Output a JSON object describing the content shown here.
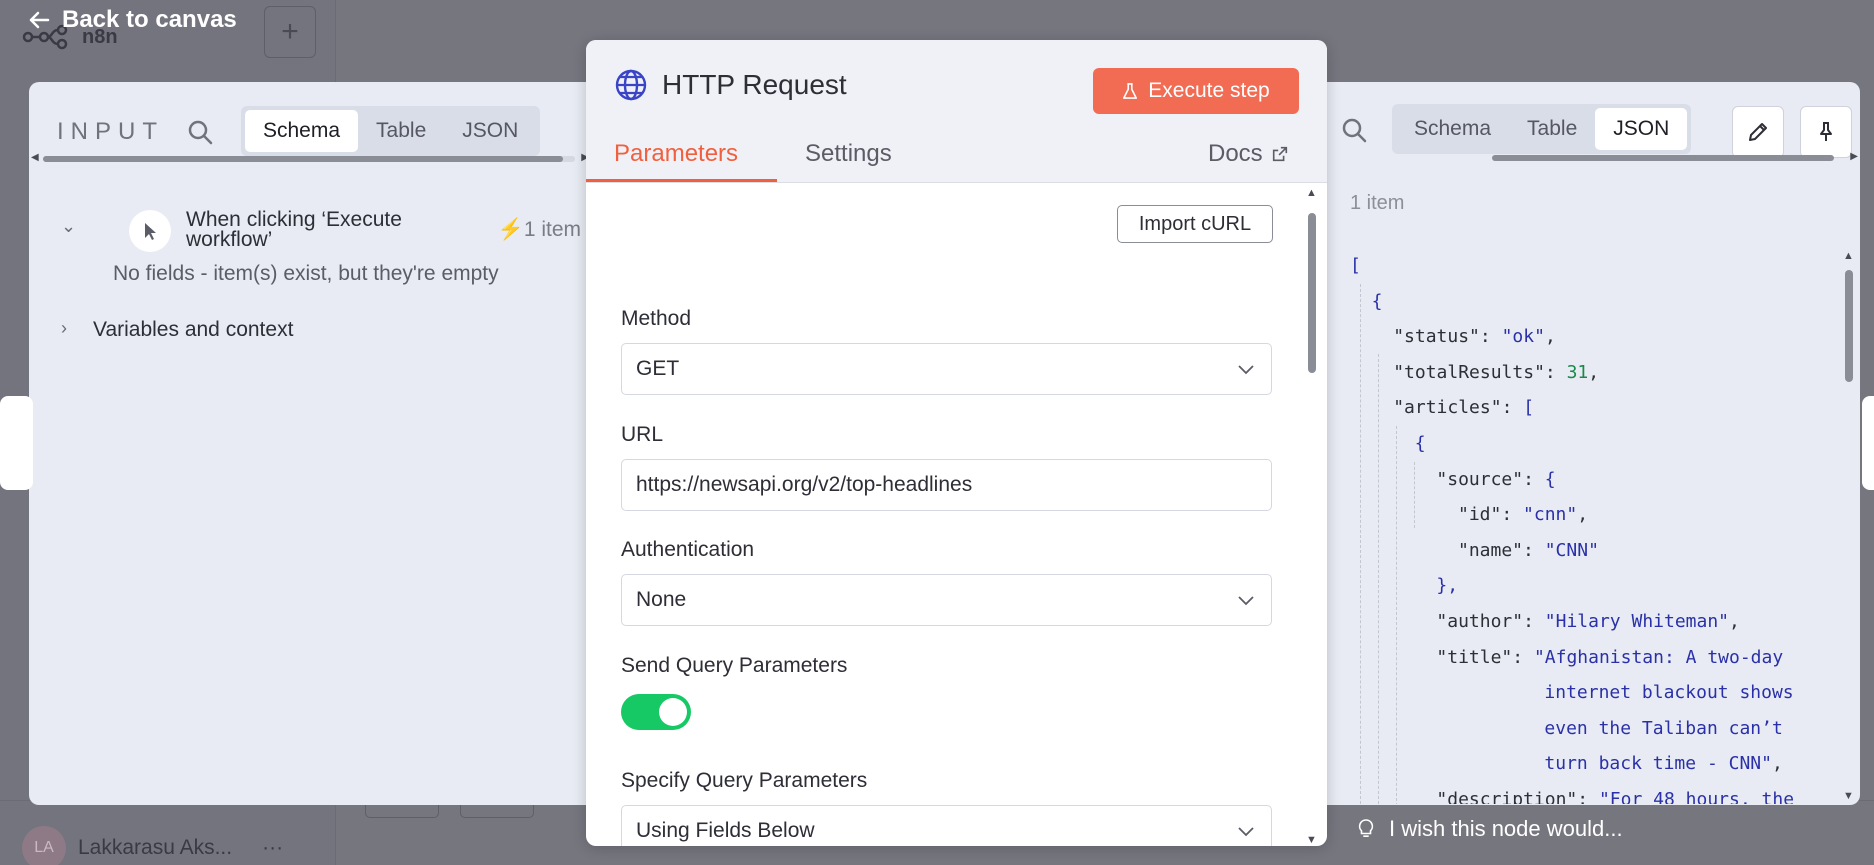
{
  "app": {
    "logo_text": "n8n",
    "user_initials": "LA",
    "user_name": "Lakkarasu Aks...",
    "user_menu": "···"
  },
  "back": {
    "label": "Back to canvas"
  },
  "input_panel": {
    "title": "INPUT",
    "tabs": [
      "Schema",
      "Table",
      "JSON"
    ],
    "active_tab": "Schema",
    "node": {
      "label": "When clicking ‘Execute workflow’",
      "count": "1 item"
    },
    "empty_message": "No fields - item(s) exist, but they're empty",
    "variables_label": "Variables and context"
  },
  "modal": {
    "title": "HTTP Request",
    "execute_label": "Execute step",
    "tabs": [
      "Parameters",
      "Settings"
    ],
    "active_tab": "Parameters",
    "docs_label": "Docs",
    "import_curl_label": "Import cURL",
    "fields": {
      "method": {
        "label": "Method",
        "value": "GET"
      },
      "url": {
        "label": "URL",
        "value": "https://newsapi.org/v2/top-headlines"
      },
      "authentication": {
        "label": "Authentication",
        "value": "None"
      },
      "send_query": {
        "label": "Send Query Parameters",
        "enabled": true
      },
      "specify_query": {
        "label": "Specify Query Parameters",
        "value": "Using Fields Below"
      }
    }
  },
  "output_panel": {
    "tabs": [
      "Schema",
      "Table",
      "JSON"
    ],
    "active_tab": "JSON",
    "items_count": "1 item",
    "json_lines": [
      [
        {
          "t": "p",
          "v": "["
        }
      ],
      [
        {
          "t": "p",
          "v": "{"
        }
      ],
      [
        {
          "t": "k",
          "v": "\"status\""
        },
        {
          "t": "k",
          "v": ": "
        },
        {
          "t": "s",
          "v": "\"ok\""
        },
        {
          "t": "k",
          "v": ","
        }
      ],
      [
        {
          "t": "k",
          "v": "\"totalResults\""
        },
        {
          "t": "k",
          "v": ": "
        },
        {
          "t": "n",
          "v": "31"
        },
        {
          "t": "k",
          "v": ","
        }
      ],
      [
        {
          "t": "k",
          "v": "\"articles\""
        },
        {
          "t": "k",
          "v": ": "
        },
        {
          "t": "p",
          "v": "["
        }
      ],
      [
        {
          "t": "p",
          "v": "{"
        }
      ],
      [
        {
          "t": "k",
          "v": "\"source\""
        },
        {
          "t": "k",
          "v": ": "
        },
        {
          "t": "p",
          "v": "{"
        }
      ],
      [
        {
          "t": "k",
          "v": "\"id\""
        },
        {
          "t": "k",
          "v": ": "
        },
        {
          "t": "s",
          "v": "\"cnn\""
        },
        {
          "t": "k",
          "v": ","
        }
      ],
      [
        {
          "t": "k",
          "v": "\"name\""
        },
        {
          "t": "k",
          "v": ": "
        },
        {
          "t": "s",
          "v": "\"CNN\""
        }
      ],
      [
        {
          "t": "p",
          "v": "},"
        }
      ],
      [
        {
          "t": "k",
          "v": "\"author\""
        },
        {
          "t": "k",
          "v": ": "
        },
        {
          "t": "s",
          "v": "\"Hilary Whiteman\""
        },
        {
          "t": "k",
          "v": ","
        }
      ],
      [
        {
          "t": "k",
          "v": "\"title\""
        },
        {
          "t": "k",
          "v": ": "
        },
        {
          "t": "s",
          "v": "\"Afghanistan: A two-day"
        }
      ],
      [
        {
          "t": "s",
          "v": "internet blackout shows"
        }
      ],
      [
        {
          "t": "s",
          "v": "even the Taliban can’t"
        }
      ],
      [
        {
          "t": "s",
          "v": "turn back time - CNN\""
        },
        {
          "t": "k",
          "v": ","
        }
      ],
      [
        {
          "t": "k",
          "v": "\"description\""
        },
        {
          "t": "k",
          "v": ": "
        },
        {
          "t": "s",
          "v": "\"For 48 hours, the"
        }
      ]
    ],
    "json_indents": [
      0,
      1,
      2,
      2,
      2,
      3,
      4,
      5,
      5,
      4,
      4,
      4,
      9,
      9,
      9,
      4
    ]
  },
  "wish_text": "I wish this node would...",
  "colors": {
    "accent": "#f0603e",
    "execute_bg": "#f26b53",
    "toggle_on": "#17c964",
    "json_string": "#2a31a8",
    "json_number": "#1a8a4a"
  }
}
